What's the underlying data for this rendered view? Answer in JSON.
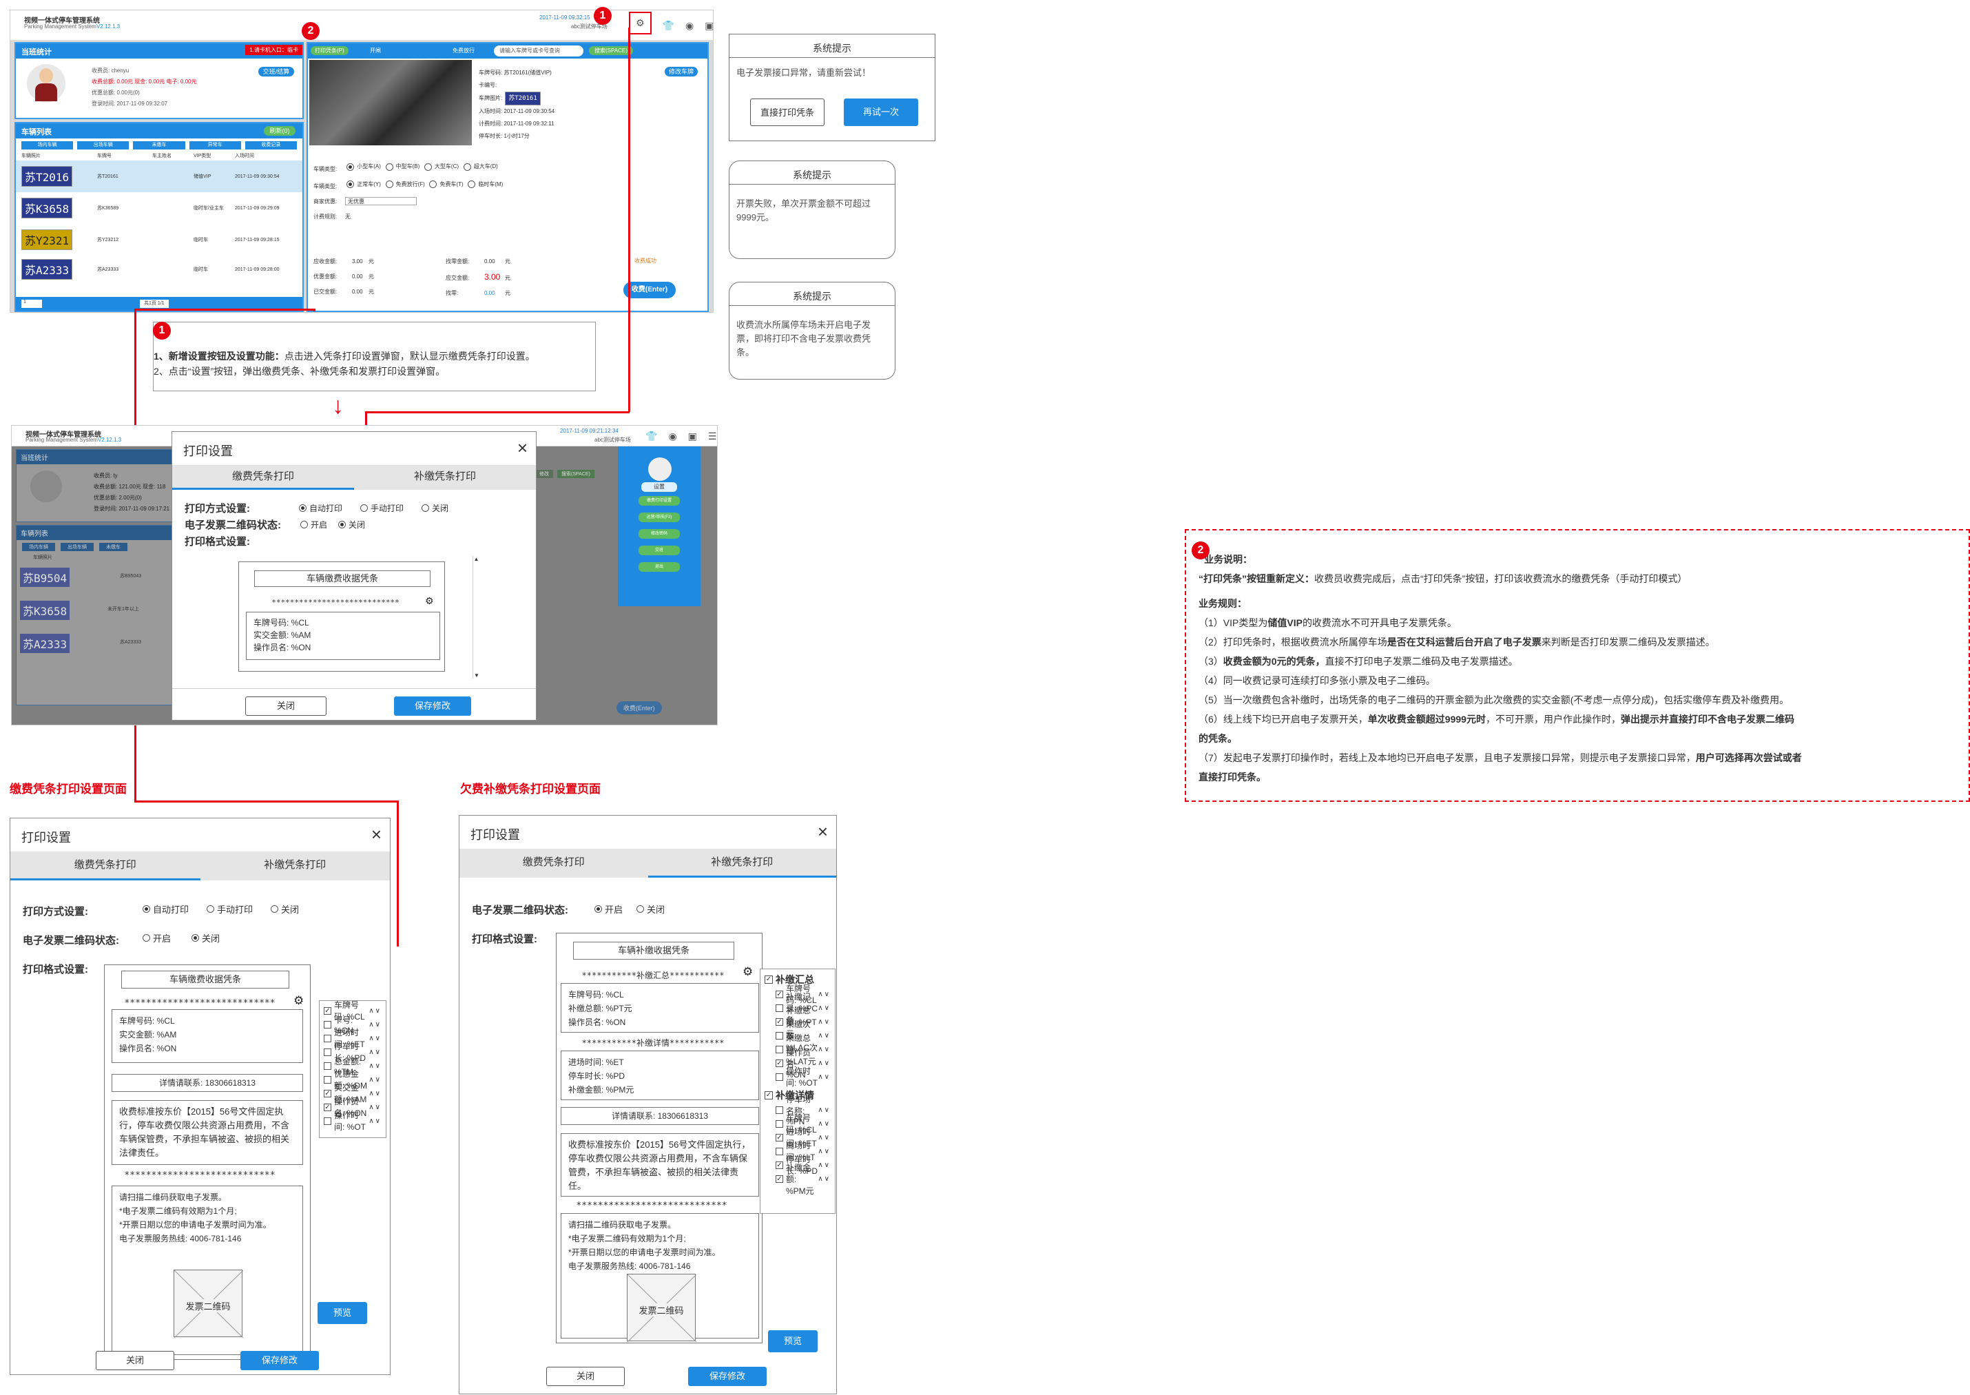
{
  "app1": {
    "title": "视频一体式停车管理系统",
    "subtitle": "Parking Management System",
    "version": "V2.12.1.3",
    "datetime": "2017-11-09 09:32:15",
    "user_line": "abc测试停车场",
    "stats_panel": {
      "title": "当班统计",
      "handover_btn": "交班/结算",
      "rows": [
        "收费员: chenyu",
        "收费总额: 0.00元 现金: 0.00元 电子: 0.00元",
        "优惠总额: 0.00元(0)",
        "登录时间: 2017-11-09 09:32:07"
      ]
    },
    "vehicle_list": {
      "title": "车辆列表",
      "query_btn": "刷新(0)",
      "tabs": [
        "场内车辆",
        "出场车辆",
        "未缴车",
        "异常车",
        "收费记录"
      ],
      "cols": [
        "车辆照片",
        "车牌号",
        "车主姓名",
        "VIP类型",
        "入场时间"
      ],
      "rows": [
        {
          "plate": "苏T2016",
          "plate_no": "苏T20161",
          "vip": "储值VIP",
          "time": "2017-11-09 09:30:54"
        },
        {
          "plate": "苏K3658",
          "plate_no": "苏K36589",
          "vip": "临时车/业主车",
          "time": "2017-11-09 09:29:09"
        },
        {
          "plate": "苏Y2321",
          "plate_no": "苏Y23212",
          "vip": "临时车",
          "time": "2017-11-09 09:28:15"
        },
        {
          "plate": "苏A2333",
          "plate_no": "苏A23333",
          "vip": "临时车",
          "time": "2017-11-09 09:28:00"
        }
      ],
      "pager": "共1页 1/1",
      "page_select": "1"
    },
    "charge_panel": {
      "print_btn": "打印凭条(P)",
      "open_gate": "开闸",
      "pay_lbl": "免费放行",
      "search_placeholder": "请输入车牌号或卡号查询",
      "space_btn": "搜索(SPACE)",
      "record_btn": "修改车牌",
      "info": [
        "车牌号码: 苏T20161(储值VIP)",
        "卡编号:",
        "车牌图片:",
        "入场时间: 2017-11-09 09:30:54",
        "计费时间: 2017-11-09 09:32:11",
        "停车时长: 1小时17分"
      ],
      "vehicle_type_label": "车辆类型:",
      "vehicle_types": [
        "小型车(A)",
        "中型车(B)",
        "大型车(C)",
        "超大车(D)"
      ],
      "charge_type_label": "车辆类型:",
      "charge_types": [
        "正常车(Y)",
        "免费放行(F)",
        "免费车(T)",
        "临时车(M)"
      ],
      "discount_label": "商家优惠:",
      "discount_value": "无优惠",
      "calc_label": "计费规则:",
      "calc_value": "无",
      "amounts_left": [
        [
          "应收金额:",
          "3.00",
          "元"
        ],
        [
          "优惠金额:",
          "0.00",
          "元"
        ],
        [
          "已交金额:",
          "0.00",
          "元"
        ]
      ],
      "amounts_right": [
        [
          "找零金额:",
          "0.00",
          "元"
        ],
        [
          "应交金额:",
          "3.00",
          "元"
        ],
        [
          "找零:",
          "0.00",
          "元"
        ]
      ],
      "status": "收费成功",
      "charge_btn": "收费(Enter)"
    },
    "red_tag": "1.请卡机入口：临卡"
  },
  "alerts": [
    {
      "title": "系统提示",
      "message": "电子发票接口异常，请重新尝试！",
      "btn_left": "直接打印凭条",
      "btn_right": "再试一次"
    },
    {
      "title": "系统提示",
      "message": "开票失败，单次开票金额不可超过9999元。"
    },
    {
      "title": "系统提示",
      "message": "收费流水所属停车场未开启电子发票，即将打印不含电子发票收费凭条。"
    }
  ],
  "note1": {
    "line1_bold": "1、新增设置按钮及设置功能：",
    "line1": "点击进入凭条打印设置弹窗，默认显示缴费凭条打印设置。",
    "line2": "2、点击“设置”按钮，弹出缴费凭条、补缴凭条和发票打印设置弹窗。"
  },
  "app2": {
    "title": "视频一体式停车管理系统",
    "subtitle": "Parking Management System",
    "version": "V2.12.1.3",
    "datetime": "2017-11-09 09:21:12:34",
    "user_line": "abc测试停车场",
    "stats_title": "当班统计",
    "stats_rows": [
      "收费员: ty",
      "收费总额: 121.00元 现金: 118",
      "优惠总额: 2.00元(0)",
      "登录时间: 2017-11-09 09:17:21"
    ],
    "list_title": "车辆列表",
    "list_tabs": [
      "场内车辆",
      "出场车辆",
      "未缴车"
    ],
    "list_col": "车辆照片",
    "plates": [
      "苏B9504",
      "苏K3658",
      "苏A2333"
    ],
    "plate_nos": [
      "苏B95043",
      "苏K36589",
      "苏A23333"
    ],
    "remark": "未开车1年以上",
    "menu": {
      "title": "设置",
      "items": [
        "缴费打印设置",
        "运营/审核(F2)",
        "修改密码",
        "交班",
        "退出"
      ]
    },
    "header_btns": [
      "修改",
      "搜索(SPACE)"
    ],
    "charge_btn": "收费(Enter)",
    "dialog": {
      "title": "打印设置",
      "tabs": [
        "缴费凭条打印",
        "补缴凭条打印"
      ],
      "print_mode_label": "打印方式设置:",
      "print_modes": [
        "自动打印",
        "手动打印",
        "关闭"
      ],
      "qr_label": "电子发票二维码状态:",
      "qr_modes": [
        "开启",
        "关闭"
      ],
      "format_label": "打印格式设置:",
      "receipt_title": "车辆缴费收据凭条",
      "stars": "****************************",
      "lines": [
        "车牌号码: %CL",
        "实交金额: %AM",
        "操作员名: %ON"
      ],
      "close": "关闭",
      "save": "保存修改"
    }
  },
  "note2": {
    "title": "业务说明：",
    "def_bold": "“打印凭条”按钮重新定义：",
    "def": "收费员收费完成后，点击“打印凭条”按钮，打印该收费流水的缴费凭条（手动打印模式）",
    "rules_title": "业务规则：",
    "r1a": "（1）VIP类型为",
    "r1b": "储值VIP",
    "r1c": "的收费流水不可开具电子发票凭条。",
    "r2a": "（2）打印凭条时，根据收费流水所属停车场",
    "r2b": "是否在艾科运营后台开启了电子发票",
    "r2c": "来判断是否打印发票二维码及发票描述。",
    "r3a": "（3）",
    "r3b": "收费金额为0元的凭条，",
    "r3c": "直接不打印电子发票二维码及电子发票描述。",
    "r4": "（4）同一收费记录可连续打印多张小票及电子二维码。",
    "r5": "（5）当一次缴费包含补缴时，出场凭条的电子二维码的开票金额为此次缴费的实交金额(不考虑一点停分成)，包括实缴停车费及补缴费用。",
    "r6a": "（6）线上线下均已开启电子发票开关，",
    "r6b": "单次收费金额超过9999元时",
    "r6c": "，不可开票，用户作此操作时，",
    "r6d": "弹出提示并直接打印不含电子发票二维码",
    "r6e": "的凭条。",
    "r7a": "（7）发起电子发票打印操作时，若线上及本地均已开启电子发票，且电子发票接口异常，则提示电子发票接口异常，",
    "r7b": "用户可选择再次尝试或者",
    "r7c": "直接打印凭条。"
  },
  "sections": {
    "left": "缴费凭条打印设置页面",
    "right": "欠费补缴凭条打印设置页面"
  },
  "dlg_left": {
    "title": "打印设置",
    "tabs": [
      "缴费凭条打印",
      "补缴凭条打印"
    ],
    "print_mode_label": "打印方式设置:",
    "print_modes": [
      "自动打印",
      "手动打印",
      "关闭"
    ],
    "qr_label": "电子发票二维码状态:",
    "qr_modes": [
      "开启",
      "关闭"
    ],
    "format_label": "打印格式设置:",
    "receipt_title": "车辆缴费收据凭条",
    "stars": "****************************",
    "lines": [
      "车牌号码: %CL",
      "实交金额: %AM",
      "操作员名: %ON"
    ],
    "contact": "详情请联系: 18306618313",
    "policy": "收费标准按东价【2015】56号文件固定执行，停车收费仅限公共资源占用费用，不含车辆保管费，不承担车辆被盗、被损的相关法律责任。",
    "stars2": "****************************",
    "invoice": [
      "请扫描二维码获取电子发票。",
      "*电子发票二维码有效期为1个月;",
      "*开票日期以您的申请电子发票时间为准。",
      "电子发票服务热线: 4006-781-146"
    ],
    "qr_text": "发票二维码",
    "fields": [
      {
        "label": "车牌号码: %CL",
        "checked": true
      },
      {
        "label": "卡号: %CN",
        "checked": false
      },
      {
        "label": "进场时间: %ET",
        "checked": false
      },
      {
        "label": "停车时长: %PD",
        "checked": false
      },
      {
        "label": "总金额: %TM",
        "checked": false
      },
      {
        "label": "优惠金额: %DM",
        "checked": false
      },
      {
        "label": "实交金额: %AM",
        "checked": true
      },
      {
        "label": "操作员名: %ON",
        "checked": true
      },
      {
        "label": "操作时间: %OT",
        "checked": false
      }
    ],
    "preview": "预览",
    "close": "关闭",
    "save": "保存修改"
  },
  "dlg_right": {
    "title": "打印设置",
    "tabs": [
      "缴费凭条打印",
      "补缴凭条打印"
    ],
    "qr_label": "电子发票二维码状态:",
    "qr_modes": [
      "开启",
      "关闭"
    ],
    "format_label": "打印格式设置:",
    "receipt_title": "车辆补缴收据凭条",
    "summary_stars": "***********补缴汇总***********",
    "summary_lines": [
      "车牌号码: %CL",
      "补缴总额: %PT元",
      "操作员名: %ON"
    ],
    "detail_stars": "***********补缴详情***********",
    "detail_lines": [
      "进场时间: %ET",
      "停车时长: %PD",
      "补缴金额: %PM元"
    ],
    "contact": "详情请联系: 18306618313",
    "policy": "收费标准按东价【2015】56号文件固定执行，停车收费仅限公共资源占用费用，不含车辆保管费，不承担车辆被盗、被损的相关法律责任。",
    "stars2": "****************************",
    "invoice": [
      "请扫描二维码获取电子发票。",
      "*电子发票二维码有效期为1个月;",
      "*开票日期以您的申请电子发票时间为准。",
      "电子发票服务热线: 4006-781-146"
    ],
    "qr_text": "发票二维码",
    "group1": "补缴汇总",
    "group1_fields": [
      {
        "label": "车牌号码: %CL",
        "checked": true
      },
      {
        "label": "补缴记录: %PC条",
        "checked": false
      },
      {
        "label": "补缴总额: %PT元",
        "checked": true
      },
      {
        "label": "未缴次数: %LAC次",
        "checked": false
      },
      {
        "label": "未缴总额: %LAT元",
        "checked": false
      },
      {
        "label": "操作员名: %ON",
        "checked": true
      },
      {
        "label": "操作时间: %OT",
        "checked": false
      }
    ],
    "group2": "补缴详情",
    "group2_fields": [
      {
        "label": "停车场名称: %PN",
        "checked": false
      },
      {
        "label": "车牌号码: %CL",
        "checked": false
      },
      {
        "label": "进场时间: %ET",
        "checked": true
      },
      {
        "label": "离场时间: %LT",
        "checked": false
      },
      {
        "label": "停车时长: %PD",
        "checked": true
      },
      {
        "label": "补缴金额: %PM元",
        "checked": true
      }
    ],
    "preview": "预览",
    "close": "关闭",
    "save": "保存修改"
  },
  "colors": {
    "accent": "#1f8be0",
    "red": "#e60012",
    "panel_border": "#3d9be9"
  },
  "icons": [
    "gear-icon",
    "shirt-icon",
    "user-icon",
    "window-icon",
    "menu-icon",
    "close-icon",
    "chevron-up-icon",
    "chevron-down-icon"
  ]
}
